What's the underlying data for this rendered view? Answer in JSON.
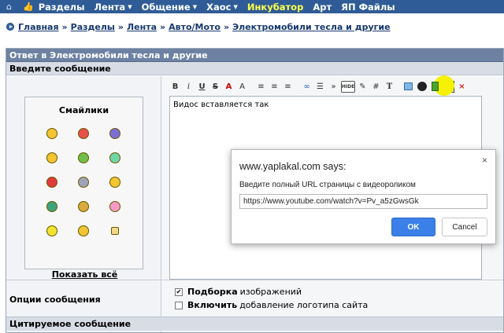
{
  "topnav": {
    "items": [
      {
        "label": "Разделы",
        "caret": false
      },
      {
        "label": "Лента",
        "caret": true
      },
      {
        "label": "Общение",
        "caret": true
      },
      {
        "label": "Хаос",
        "caret": true
      },
      {
        "label": "Инкубатор",
        "caret": false,
        "highlight": true
      },
      {
        "label": "Арт",
        "caret": false
      },
      {
        "label": "ЯП Файлы",
        "caret": false
      }
    ],
    "home_icon": "home-icon",
    "thumb_icon": "thumbs-up-icon",
    "caret_glyph": "▼"
  },
  "breadcrumb": {
    "items": [
      "Главная",
      "Разделы",
      "Лента",
      "Авто/Мото",
      "Электромобили тесла и другие"
    ],
    "separator": "»"
  },
  "form": {
    "title": "Ответ в Электромобили тесла и другие",
    "enter_message": "Введите сообщение",
    "smilies_title": "Смайлики",
    "show_all": "Показать всё",
    "editor_text": "Видос вставляется так",
    "options_label": "Опции сообщения",
    "option1_bold": "Подборка",
    "option1_rest": "изображений",
    "option1_checked": true,
    "option2_bold": "Включить",
    "option2_rest": "добавление логотипа сайта",
    "option2_checked": false,
    "quoted_header": "Цитируемое сообщение"
  },
  "toolbar": {
    "bold": "B",
    "italic": "i",
    "underline": "U",
    "strike": "S",
    "color": "A",
    "size": "A",
    "code": "»",
    "hash": "#",
    "text": "T",
    "hide": "HIDE",
    "close": "×",
    "highlight_color": "#f4f200"
  },
  "dialog": {
    "title": "www.yaplakal.com says:",
    "message": "Введите полный URL страницы с видеороликом",
    "input_value": "https://www.youtube.com/watch?v=Pv_a5zGwsGk",
    "ok": "OK",
    "cancel": "Cancel",
    "close": "×"
  },
  "colors": {
    "nav_bg": "#2f5c96",
    "title_bar": "#6d82a2",
    "section_bg": "#d8dde5",
    "ok_button": "#3b80e8"
  }
}
